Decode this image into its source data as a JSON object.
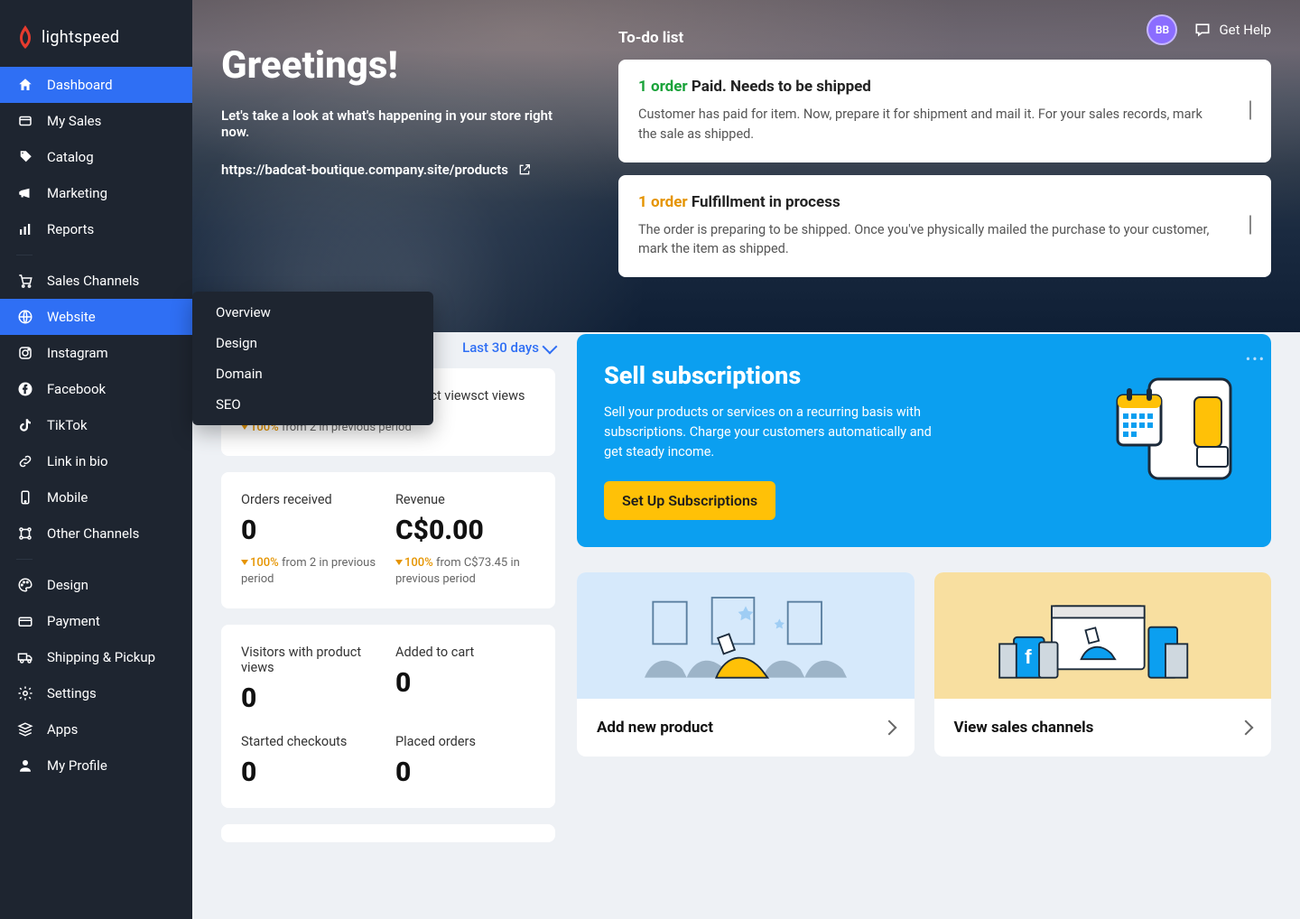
{
  "brand": {
    "name": "lightspeed"
  },
  "topbar": {
    "avatar_initials": "BB",
    "help_label": "Get Help"
  },
  "sidebar": {
    "items": [
      {
        "label": "Dashboard",
        "icon": "home-icon",
        "active": true
      },
      {
        "label": "My Sales",
        "icon": "tag-icon"
      },
      {
        "label": "Catalog",
        "icon": "price-tag-icon"
      },
      {
        "label": "Marketing",
        "icon": "megaphone-icon"
      },
      {
        "label": "Reports",
        "icon": "bar-chart-icon"
      }
    ],
    "channels_header": "Sales Channels",
    "channels": [
      {
        "label": "Website",
        "icon": "globe-icon",
        "selected": true
      },
      {
        "label": "Instagram",
        "icon": "instagram-icon"
      },
      {
        "label": "Facebook",
        "icon": "facebook-icon"
      },
      {
        "label": "TikTok",
        "icon": "tiktok-icon"
      },
      {
        "label": "Link in bio",
        "icon": "link-icon"
      },
      {
        "label": "Mobile",
        "icon": "mobile-icon"
      },
      {
        "label": "Other Channels",
        "icon": "channels-icon"
      }
    ],
    "bottom": [
      {
        "label": "Design",
        "icon": "palette-icon"
      },
      {
        "label": "Payment",
        "icon": "wallet-icon"
      },
      {
        "label": "Shipping & Pickup",
        "icon": "truck-icon"
      },
      {
        "label": "Settings",
        "icon": "gear-icon"
      },
      {
        "label": "Apps",
        "icon": "stack-icon"
      },
      {
        "label": "My Profile",
        "icon": "person-icon"
      }
    ]
  },
  "submenu": {
    "items": [
      "Overview",
      "Design",
      "Domain",
      "SEO"
    ]
  },
  "hero": {
    "title": "Greetings!",
    "subtitle": "Let's take a look at what's happening in your store right now.",
    "store_url": "https://badcat-boutique.company.site/products"
  },
  "todo": {
    "title": "To-do list",
    "items": [
      {
        "count_text": "1 order",
        "count_color": "green",
        "status": "Paid. Needs to be shipped",
        "desc": "Customer has paid for item. Now, prepare it for shipment and mail it. For your sales records, mark the sale as shipped."
      },
      {
        "count_text": "1 order",
        "count_color": "orange",
        "status": "Fulfillment in process",
        "desc": "The order is preparing to be shipped. Once you've physically mailed the purchase to your customer, mark the item as shipped."
      }
    ]
  },
  "period": {
    "label": "Last 30 days"
  },
  "stats": {
    "card1": {
      "right_label": "Product views",
      "left_value_hidden": "",
      "delta_pct": "100%",
      "delta_rest": "from 2 in previous period"
    },
    "card2": {
      "l_label": "Orders received",
      "l_value": "0",
      "l_delta_pct": "100%",
      "l_delta_rest": "from 2 in previous period",
      "r_label": "Revenue",
      "r_value": "C$0.00",
      "r_delta_pct": "100%",
      "r_delta_rest": "from C$73.45 in previous period"
    },
    "card3": {
      "r1_l_label": "Visitors with product views",
      "r1_l_value": "0",
      "r1_r_label": "Added to cart",
      "r1_r_value": "0",
      "r2_l_label": "Started checkouts",
      "r2_l_value": "0",
      "r2_r_label": "Placed orders",
      "r2_r_value": "0"
    }
  },
  "subscriptions": {
    "title": "Sell subscriptions",
    "desc": "Sell your products or services on a recurring basis with subscriptions. Charge your customers automatically and get steady income.",
    "button": "Set Up Subscriptions"
  },
  "quick_actions": {
    "add_product": "Add new product",
    "view_channels": "View sales channels"
  }
}
